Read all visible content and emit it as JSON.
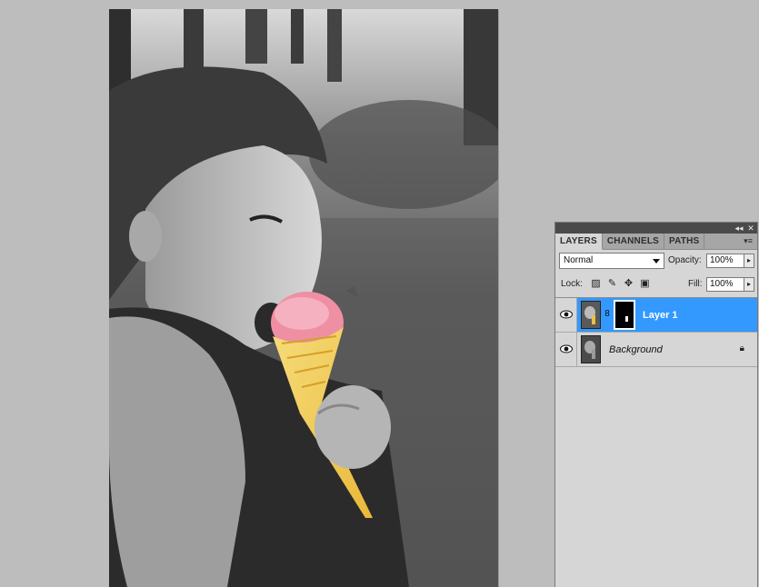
{
  "panel": {
    "tabs": [
      {
        "label": "LAYERS",
        "active": true
      },
      {
        "label": "CHANNELS",
        "active": false
      },
      {
        "label": "PATHS",
        "active": false
      }
    ],
    "menu_icon": "panel-menu-icon",
    "blend_mode": "Normal",
    "opacity_label": "Opacity:",
    "opacity_value": "100%",
    "lock_label": "Lock:",
    "lock_icons": [
      "lock-transparent-pixels-icon",
      "lock-image-pixels-icon",
      "lock-position-icon",
      "lock-all-icon"
    ],
    "fill_label": "Fill:",
    "fill_value": "100%",
    "layers": [
      {
        "name": "Layer 1",
        "selected": true,
        "has_mask": true,
        "visible": true
      },
      {
        "name": "Background",
        "selected": false,
        "locked": true,
        "visible": true
      }
    ]
  },
  "colors": {
    "workspace": "#bdbdbd",
    "panel": "#d6d6d6",
    "selection": "#3399ff"
  }
}
